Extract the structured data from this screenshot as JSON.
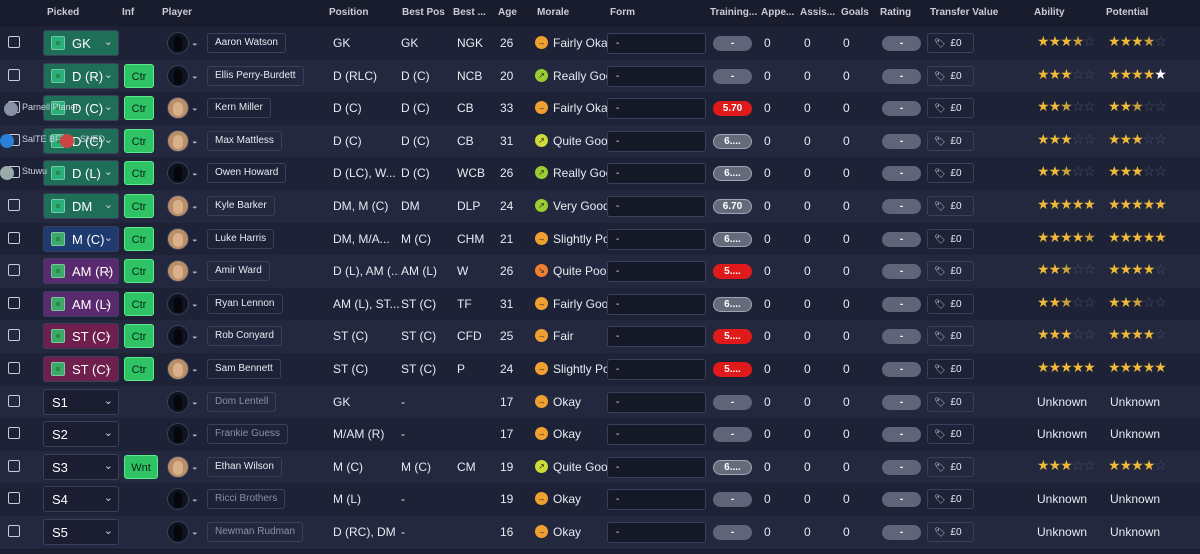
{
  "header": [
    "Picked",
    "Inf",
    "Player",
    "Position",
    "Best Pos",
    "Best ...",
    "Age",
    "Morale",
    "Form",
    "Training...",
    "Appe...",
    "Assis...",
    "Goals",
    "Rating",
    "Transfer Value",
    "Ability",
    "Potential"
  ],
  "rows": [
    {
      "pos": "GK",
      "posColor": "#1f6e58",
      "swColor": "#29b07a",
      "inf": "",
      "name": "Aaron Watson",
      "dim": false,
      "real": false,
      "position": "GK",
      "best_pos": "GK",
      "best_role": "NGK",
      "age": "26",
      "morale_icon": "→",
      "morale_color": "#f0a030",
      "morale": "Fairly Okay",
      "form": "-",
      "training": "-",
      "train_style": "grey2",
      "apps": "0",
      "assists": "0",
      "goals": "0",
      "rating": "-",
      "tv": "£0",
      "ability": "fffhe",
      "potential": "fffhe"
    },
    {
      "pos": "D (R)",
      "posColor": "#1f6e58",
      "swColor": "#29b07a",
      "inf": "Ctr",
      "name": "Ellis Perry-Burdett",
      "dim": false,
      "real": false,
      "position": "D (RLC)",
      "best_pos": "D (C)",
      "best_role": "NCB",
      "age": "20",
      "morale_icon": "↗",
      "morale_color": "#9acd32",
      "morale": "Really Good",
      "form": "-",
      "training": "-",
      "train_style": "grey2",
      "apps": "0",
      "assists": "0",
      "goals": "0",
      "rating": "-",
      "tv": "£0",
      "ability": "fffee",
      "potential": "ffffw"
    },
    {
      "pos": "D (C)",
      "posColor": "#1f6e58",
      "swColor": "#29b07a",
      "inf": "Ctr",
      "name": "Kern Miller",
      "dim": false,
      "real": true,
      "position": "D (C)",
      "best_pos": "D (C)",
      "best_role": "CB",
      "age": "33",
      "morale_icon": "→",
      "morale_color": "#f0a030",
      "morale": "Fairly Okay",
      "form": "-",
      "training": "5.70",
      "train_style": "red",
      "apps": "0",
      "assists": "0",
      "goals": "0",
      "rating": "-",
      "tv": "£0",
      "ability": "ffhee",
      "potential": "ffhee"
    },
    {
      "pos": "D (C)",
      "posColor": "#1f6e58",
      "swColor": "#29b07a",
      "inf": "Ctr",
      "name": "Max Mattless",
      "dim": false,
      "real": true,
      "position": "D (C)",
      "best_pos": "D (C)",
      "best_role": "CB",
      "age": "31",
      "morale_icon": "↗",
      "morale_color": "#cddc39",
      "morale": "Quite Good",
      "form": "-",
      "training": "6....",
      "train_style": "grey",
      "apps": "0",
      "assists": "0",
      "goals": "0",
      "rating": "-",
      "tv": "£0",
      "ability": "fffee",
      "potential": "fffee"
    },
    {
      "pos": "D (L)",
      "posColor": "#1f6e58",
      "swColor": "#29b07a",
      "inf": "Ctr",
      "name": "Owen Howard",
      "dim": false,
      "real": false,
      "position": "D (LC), W...",
      "best_pos": "D (C)",
      "best_role": "WCB",
      "age": "26",
      "morale_icon": "↗",
      "morale_color": "#9acd32",
      "morale": "Really Good",
      "form": "-",
      "training": "6....",
      "train_style": "grey",
      "apps": "0",
      "assists": "0",
      "goals": "0",
      "rating": "-",
      "tv": "£0",
      "ability": "ffhee",
      "potential": "fffee"
    },
    {
      "pos": "DM",
      "posColor": "#1f6e58",
      "swColor": "#29b07a",
      "inf": "Ctr",
      "name": "Kyle Barker",
      "dim": false,
      "real": true,
      "position": "DM, M (C)",
      "best_pos": "DM",
      "best_role": "DLP",
      "age": "24",
      "morale_icon": "↗",
      "morale_color": "#9acd32",
      "morale": "Very Good",
      "form": "-",
      "training": "6.70",
      "train_style": "grey",
      "apps": "0",
      "assists": "0",
      "goals": "0",
      "rating": "-",
      "tv": "£0",
      "ability": "fffff",
      "potential": "fffff"
    },
    {
      "pos": "M (C)",
      "posColor": "#1e3a6e",
      "swColor": "#3aa96a",
      "inf": "Ctr",
      "name": "Luke Harris",
      "dim": false,
      "real": true,
      "position": "DM, M/A...",
      "best_pos": "M (C)",
      "best_role": "CHM",
      "age": "21",
      "morale_icon": "→",
      "morale_color": "#f0a030",
      "morale": "Slightly Poor",
      "form": "-",
      "training": "6....",
      "train_style": "grey",
      "apps": "0",
      "assists": "0",
      "goals": "0",
      "rating": "-",
      "tv": "£0",
      "ability": "ffffh",
      "potential": "fffff"
    },
    {
      "pos": "AM (R)",
      "posColor": "#5a2a6e",
      "swColor": "#3aa96a",
      "inf": "Ctr",
      "name": "Amir Ward",
      "dim": false,
      "real": true,
      "position": "D (L), AM (...",
      "best_pos": "AM (L)",
      "best_role": "W",
      "age": "26",
      "morale_icon": "↘",
      "morale_color": "#f08030",
      "morale": "Quite Poor",
      "form": "-",
      "training": "5....",
      "train_style": "red",
      "apps": "0",
      "assists": "0",
      "goals": "0",
      "rating": "-",
      "tv": "£0",
      "ability": "ffhee",
      "potential": "ffffe"
    },
    {
      "pos": "AM (L)",
      "posColor": "#5a2a6e",
      "swColor": "#3aa96a",
      "inf": "Ctr",
      "name": "Ryan Lennon",
      "dim": false,
      "real": false,
      "position": "AM (L), ST...",
      "best_pos": "ST (C)",
      "best_role": "TF",
      "age": "31",
      "morale_icon": "→",
      "morale_color": "#f0a030",
      "morale": "Fairly Good",
      "form": "-",
      "training": "6....",
      "train_style": "grey",
      "apps": "0",
      "assists": "0",
      "goals": "0",
      "rating": "-",
      "tv": "£0",
      "ability": "ffhee",
      "potential": "ffhee"
    },
    {
      "pos": "ST (C)",
      "posColor": "#6e1f4e",
      "swColor": "#3aa96a",
      "inf": "Ctr",
      "name": "Rob Conyard",
      "dim": false,
      "real": false,
      "position": "ST (C)",
      "best_pos": "ST (C)",
      "best_role": "CFD",
      "age": "25",
      "morale_icon": "→",
      "morale_color": "#f0a030",
      "morale": "Fair",
      "form": "-",
      "training": "5....",
      "train_style": "red",
      "apps": "0",
      "assists": "0",
      "goals": "0",
      "rating": "-",
      "tv": "£0",
      "ability": "fffee",
      "potential": "ffffe"
    },
    {
      "pos": "ST (C)",
      "posColor": "#6e1f4e",
      "swColor": "#3aa96a",
      "inf": "Ctr",
      "name": "Sam Bennett",
      "dim": false,
      "real": true,
      "position": "ST (C)",
      "best_pos": "ST (C)",
      "best_role": "P",
      "age": "24",
      "morale_icon": "→",
      "morale_color": "#f0a030",
      "morale": "Slightly Poor",
      "form": "-",
      "training": "5....",
      "train_style": "red",
      "apps": "0",
      "assists": "0",
      "goals": "0",
      "rating": "-",
      "tv": "£0",
      "ability": "fffff",
      "potential": "fffff"
    },
    {
      "pos": "S1",
      "sub": true,
      "inf": "",
      "name": "Dom Lentell",
      "dim": true,
      "real": false,
      "position": "GK",
      "best_pos": "-",
      "best_role": "",
      "age": "17",
      "morale_icon": "→",
      "morale_color": "#f0a030",
      "morale": "Okay",
      "form": "-",
      "training": "-",
      "train_style": "grey2",
      "apps": "0",
      "assists": "0",
      "goals": "0",
      "rating": "-",
      "tv": "£0",
      "ability_text": "Unknown",
      "potential_text": "Unknown"
    },
    {
      "pos": "S2",
      "sub": true,
      "inf": "",
      "name": "Frankie Guess",
      "dim": true,
      "real": false,
      "position": "M/AM (R)",
      "best_pos": "-",
      "best_role": "",
      "age": "17",
      "morale_icon": "→",
      "morale_color": "#f0a030",
      "morale": "Okay",
      "form": "-",
      "training": "-",
      "train_style": "grey2",
      "apps": "0",
      "assists": "0",
      "goals": "0",
      "rating": "-",
      "tv": "£0",
      "ability_text": "Unknown",
      "potential_text": "Unknown"
    },
    {
      "pos": "S3",
      "sub": true,
      "inf": "Wnt",
      "name": "Ethan Wilson",
      "dim": false,
      "real": true,
      "position": "M (C)",
      "best_pos": "M (C)",
      "best_role": "CM",
      "age": "19",
      "morale_icon": "↗",
      "morale_color": "#cddc39",
      "morale": "Quite Good",
      "form": "-",
      "training": "6....",
      "train_style": "grey",
      "apps": "0",
      "assists": "0",
      "goals": "0",
      "rating": "-",
      "tv": "£0",
      "ability": "fffee",
      "potential": "ffffe"
    },
    {
      "pos": "S4",
      "sub": true,
      "inf": "",
      "name": "Ricci Brothers",
      "dim": true,
      "real": false,
      "position": "M (L)",
      "best_pos": "-",
      "best_role": "",
      "age": "19",
      "morale_icon": "→",
      "morale_color": "#f0a030",
      "morale": "Okay",
      "form": "-",
      "training": "-",
      "train_style": "grey2",
      "apps": "0",
      "assists": "0",
      "goals": "0",
      "rating": "-",
      "tv": "£0",
      "ability_text": "Unknown",
      "potential_text": "Unknown"
    },
    {
      "pos": "S5",
      "sub": true,
      "inf": "",
      "name": "Newman Rudman",
      "dim": true,
      "real": false,
      "position": "D (RC), DM",
      "best_pos": "-",
      "best_role": "",
      "age": "16",
      "morale_icon": "→",
      "morale_color": "#f0a030",
      "morale": "Okay",
      "form": "-",
      "training": "-",
      "train_style": "grey2",
      "apps": "0",
      "assists": "0",
      "goals": "0",
      "rating": "-",
      "tv": "£0",
      "ability_text": "Unknown",
      "potential_text": "Unknown"
    }
  ],
  "overlay": [
    {
      "text": "Parnell Planer"
    },
    {
      "text": "SalTE BFM"
    },
    {
      "text": "SHED"
    },
    {
      "text": "Stuwu"
    }
  ]
}
